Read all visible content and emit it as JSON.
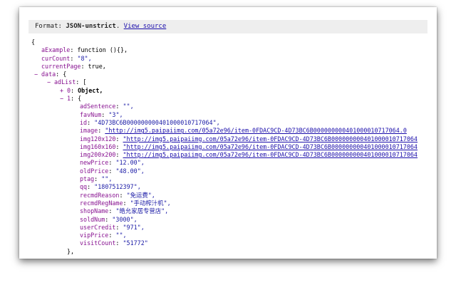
{
  "format_bar": {
    "prefix": "Format:",
    "format_name": "JSON-unstrict",
    "separator": ".",
    "view_source_label": "View source"
  },
  "json": {
    "open_brace": "{",
    "aExample_key": "aExample",
    "aExample_value": "function (){},",
    "curCount_key": "curCount",
    "curCount_value": "\"8\",",
    "currentPage_key": "currentPage",
    "currentPage_value": "true,",
    "data_toggle": "−",
    "data_key": "data",
    "data_open": "{",
    "adList_toggle": "−",
    "adList_key": "adList",
    "adList_open": "[",
    "item0_toggle": "+",
    "item0_key": "0",
    "item0_value": "Object,",
    "item1_toggle": "−",
    "item1_key": "1",
    "item1_open": "{",
    "fields": {
      "adSentence": {
        "key": "adSentence",
        "value": "\"\","
      },
      "favNum": {
        "key": "favNum",
        "value": "\"3\","
      },
      "id": {
        "key": "id",
        "value": "\"4D73BC6B000000000401000010717064\","
      },
      "image": {
        "key": "image",
        "value": "\"http://img5.paipaiimg.com/05a72e96/item-0FDAC9CD-4D73BC6B000000000401000010717064.0"
      },
      "img120x120": {
        "key": "img120x120",
        "value": "\"http://img5.paipaiimg.com/05a72e96/item-0FDAC9CD-4D73BC6B000000000401000010717064"
      },
      "img160x160": {
        "key": "img160x160",
        "value": "\"http://img5.paipaiimg.com/05a72e96/item-0FDAC9CD-4D73BC6B000000000401000010717064"
      },
      "img200x200": {
        "key": "img200x200",
        "value": "\"http://img5.paipaiimg.com/05a72e96/item-0FDAC9CD-4D73BC6B000000000401000010717064"
      },
      "newPrice": {
        "key": "newPrice",
        "value": "\"12.00\","
      },
      "oldPrice": {
        "key": "oldPrice",
        "value": "\"48.00\","
      },
      "ptag": {
        "key": "ptag",
        "value": "\"\","
      },
      "qq": {
        "key": "qq",
        "value": "\"1807512397\","
      },
      "recmdReason": {
        "key": "recmdReason",
        "value": "\"免运费\","
      },
      "recmdRegName": {
        "key": "recmdRegName",
        "value": "\"手动榨汁机\","
      },
      "shopName": {
        "key": "shopName",
        "value": "\"皓允家居专营店\","
      },
      "soldNum": {
        "key": "soldNum",
        "value": "\"3000\","
      },
      "userCredit": {
        "key": "userCredit",
        "value": "\"971\","
      },
      "vipPrice": {
        "key": "vipPrice",
        "value": "\"\","
      },
      "visitCount": {
        "key": "visitCount",
        "value": "\"51772\""
      }
    },
    "item1_close": "},"
  },
  "colors": {
    "key": "#881391",
    "string": "#1a1aa6",
    "link": "#1a0dab",
    "format_bar_bg": "#eeeeee"
  }
}
